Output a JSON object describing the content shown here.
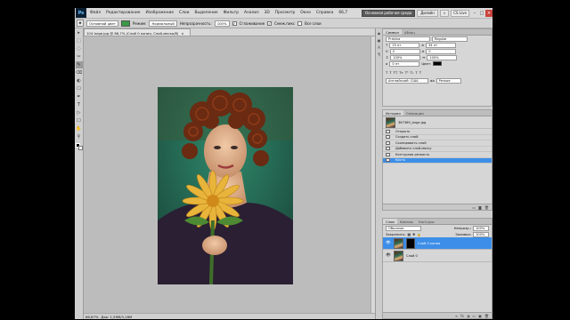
{
  "menubar": {
    "logo": "Ps",
    "items": [
      "Файл",
      "Редактирование",
      "Изображение",
      "Слои",
      "Выделение",
      "Фильтр",
      "Анализ",
      "3D",
      "Просмотр",
      "Окно",
      "Справка"
    ],
    "zoom": "66,7",
    "workspace_active": "Основная рабочая среда",
    "workspace_design": "Дизайн",
    "workspace_more": "»",
    "cs_live": "CS Live",
    "minimize": "–",
    "maximize": "□",
    "close": "×"
  },
  "options": {
    "preset": "Основной цвет",
    "mode_label": "Режим:",
    "mode_value": "Нормальный",
    "opacity_label": "Непрозрачность:",
    "opacity_value": "100%",
    "anti_alias": "Сглаживание",
    "contiguous": "Смеж.пикс",
    "all_layers": "Все слои",
    "swatch_color": "#3a9a46"
  },
  "tools": [
    "▸",
    "⬚",
    "◌",
    "✂",
    "✎",
    "⌫",
    "◐",
    "☐",
    "✒",
    "T",
    "▷",
    "☐",
    "✋",
    "⚲"
  ],
  "document": {
    "tab_title": "104 large.jpg @ 66,7% (Слой 0 копия, Слой-маска/8)",
    "tab_close": "×",
    "status_zoom": "66,67%",
    "status_doc": "Док: 1,59М/3,18М"
  },
  "character": {
    "tabs": [
      "Символ",
      "Абзац"
    ],
    "font": "Pristina",
    "style": "Regular",
    "size": "25 пт",
    "leading": "34 пт",
    "kerning": "0",
    "tracking": "0",
    "vscale": "100%",
    "hscale": "100%",
    "baseline": "0 пт",
    "color_label": "Цвет:",
    "language": "Английский: США",
    "aa": "Резкое"
  },
  "history": {
    "tabs": [
      "История",
      "Операции"
    ],
    "snapshot": "367369_large.jpg",
    "items": [
      "Открыть",
      "Создать слой",
      "Скопировать слой",
      "Добавить слой-маску",
      "Контурная резкость",
      "Кисть"
    ],
    "selected_index": 5
  },
  "layers": {
    "tabs": [
      "Слои",
      "Каналы",
      "Контуры"
    ],
    "blend_mode": "Обычные",
    "opacity_label": "Непрозр.:",
    "opacity_value": "100%",
    "lock_label": "Закрепить:",
    "fill_label": "Заливка:",
    "fill_value": "100%",
    "items": [
      {
        "name": "Слой 0 копия",
        "visible": true,
        "selected": true,
        "mask": true
      },
      {
        "name": "Слой 0",
        "visible": true,
        "selected": false,
        "mask": false
      }
    ],
    "footer_icons": [
      "∞",
      "fx",
      "◑",
      "▭",
      "▣",
      "🗑"
    ]
  },
  "icon_strip": [
    "◉",
    "▣",
    "A",
    "¶"
  ]
}
